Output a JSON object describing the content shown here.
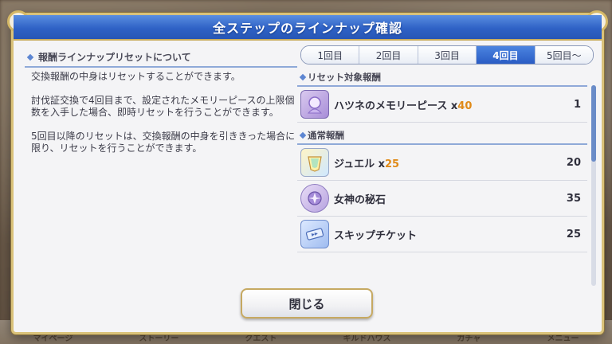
{
  "dialog": {
    "title": "全ステップのラインナップ確認"
  },
  "left_pane": {
    "heading": "報酬ラインナップリセットについて",
    "paragraphs": [
      "交換報酬の中身はリセットすることができます。",
      "討伐証交換で4回目まで、設定されたメモリーピースの上限個数を入手した場合、即時リセットを行うことができます。",
      "5回目以降のリセットは、交換報酬の中身を引ききった場合に限り、リセットを行うことができます。"
    ]
  },
  "tabs": [
    {
      "label": "1回目",
      "active": false
    },
    {
      "label": "2回目",
      "active": false
    },
    {
      "label": "3回目",
      "active": false
    },
    {
      "label": "4回目",
      "active": true
    },
    {
      "label": "5回目～",
      "active": false
    }
  ],
  "reset_section": {
    "heading": "リセット対象報酬",
    "items": [
      {
        "name": "ハツネのメモリーピース",
        "qty_prefix": "x",
        "qty": "40",
        "count": "1",
        "icon": "memory-piece-icon"
      }
    ]
  },
  "normal_section": {
    "heading": "通常報酬",
    "items": [
      {
        "name": "ジュエル",
        "qty_prefix": "x",
        "qty": "25",
        "count": "20",
        "icon": "jewel-icon"
      },
      {
        "name": "女神の秘石",
        "qty_prefix": "",
        "qty": "",
        "count": "35",
        "icon": "goddess-stone-icon"
      },
      {
        "name": "スキップチケット",
        "qty_prefix": "",
        "qty": "",
        "count": "25",
        "icon": "skip-ticket-icon"
      }
    ]
  },
  "close_button": {
    "label": "閉じる"
  },
  "background_nav": [
    "マイページ",
    "ストーリー",
    "クエスト",
    "ギルドハウス",
    "ガチャ",
    "メニュー"
  ],
  "colors": {
    "header_blue": "#2f62c6",
    "accent_gold": "#d9c27a",
    "qty_orange": "#e08a18"
  }
}
